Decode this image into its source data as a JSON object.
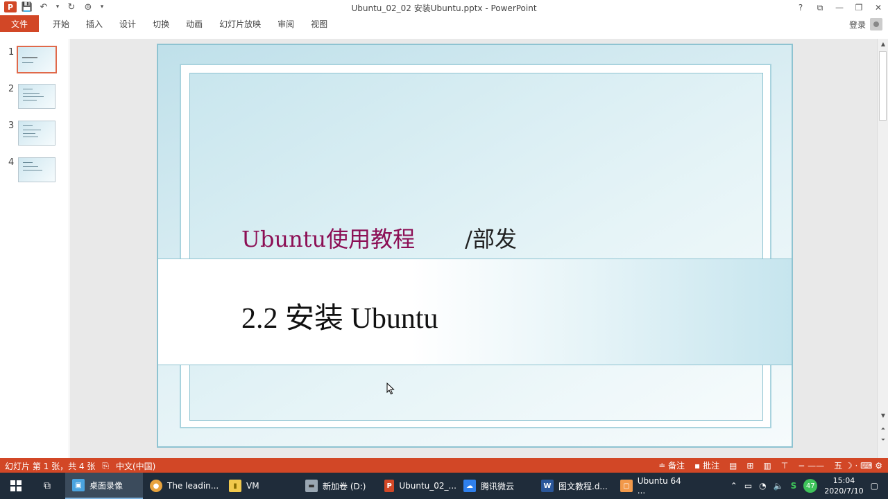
{
  "window": {
    "title": "Ubuntu_02_02 安装Ubuntu.pptx - PowerPoint",
    "app_icon_label": "P",
    "controls": [
      "?",
      "⧉",
      "—",
      "❐",
      "✕"
    ]
  },
  "ribbon": {
    "tabs": [
      "文件",
      "开始",
      "插入",
      "设计",
      "切换",
      "动画",
      "幻灯片放映",
      "审阅",
      "视图"
    ],
    "signin_label": "登录"
  },
  "thumbnails": [
    "1",
    "2",
    "3",
    "4"
  ],
  "slide": {
    "subtitle_left": "Ubuntu使用教程",
    "subtitle_right": "/部发",
    "main_title": "2.2 安装 Ubuntu"
  },
  "status": {
    "slide_info": "幻灯片 第 1 张，共 4 张",
    "language": "中文(中国)",
    "notes_label": "备注",
    "comments_label": "批注"
  },
  "taskbar": {
    "items": [
      {
        "label": "桌面录像",
        "color": "#4aa3df",
        "glyph": "▣"
      },
      {
        "label": "The leadin...",
        "color": "#e8a33d",
        "glyph": "●"
      },
      {
        "label": "VM",
        "color": "#f2c94c",
        "glyph": "▮"
      },
      {
        "label": "新加卷 (D:)",
        "color": "#9aa7b3",
        "glyph": "▬"
      },
      {
        "label": "Ubuntu_02_...",
        "color": "#d24726",
        "glyph": "P"
      },
      {
        "label": "腾讯微云",
        "color": "#2f80ed",
        "glyph": "☁"
      },
      {
        "label": "图文教程.d...",
        "color": "#2b579a",
        "glyph": "W"
      },
      {
        "label": "Ubuntu 64 ...",
        "color": "#f2994a",
        "glyph": "▢"
      }
    ],
    "badge": "47",
    "clock_time": "15:04",
    "clock_date": "2020/7/10"
  }
}
